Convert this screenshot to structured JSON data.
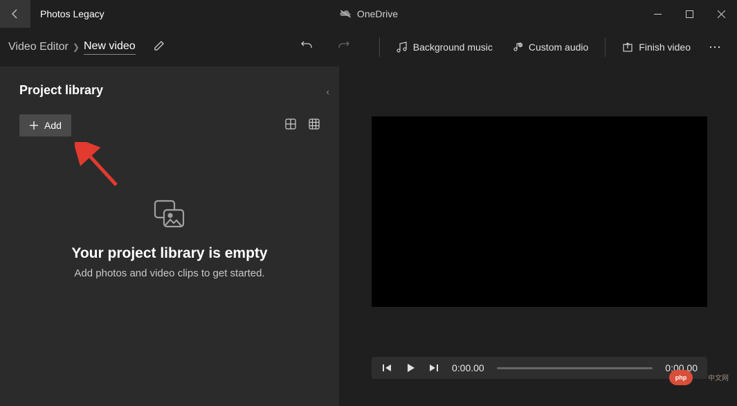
{
  "app": {
    "title": "Photos Legacy",
    "cloud": "OneDrive"
  },
  "breadcrumb": {
    "root": "Video Editor",
    "current": "New video"
  },
  "toolbar": {
    "bg_music": "Background music",
    "custom_audio": "Custom audio",
    "finish": "Finish video"
  },
  "library": {
    "title": "Project library",
    "add_label": "Add",
    "empty_title": "Your project library is empty",
    "empty_subtitle": "Add photos and video clips to get started."
  },
  "player": {
    "time_current": "0:00.00",
    "time_total": "0:00.00"
  },
  "watermark": "php",
  "watermark_side": "中文网"
}
